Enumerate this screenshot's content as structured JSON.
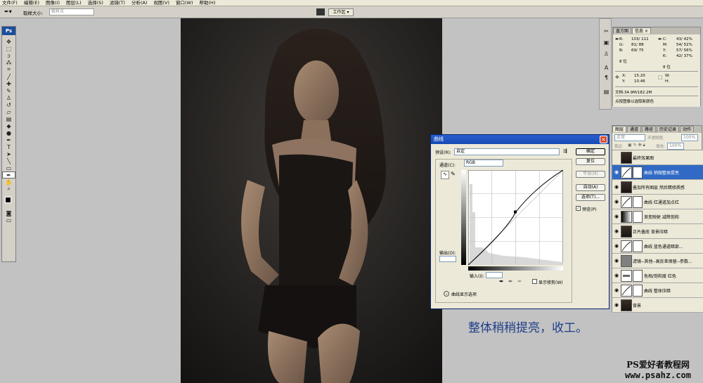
{
  "menubar": [
    "文件(F)",
    "编辑(E)",
    "图像(I)",
    "图层(L)",
    "选择(S)",
    "滤镜(T)",
    "分析(A)",
    "视图(V)",
    "窗口(W)",
    "帮助(H)"
  ],
  "optbar": {
    "sample_label": "取样大小:",
    "sample_value": "取样点",
    "workspace": "工作区 ▾"
  },
  "toolbox": {
    "logo": "Ps"
  },
  "curves": {
    "title": "曲线",
    "preset_label": "预设(R):",
    "preset_value": "自定",
    "channel_label": "通道(C):",
    "channel_value": "RGB",
    "output_label": "输出(O):",
    "input_label": "输入(I):",
    "show_clip": "显示修剪(W)",
    "display_options": "曲线显示选项",
    "buttons": {
      "ok": "确定",
      "reset": "复位",
      "smooth": "平滑(M)",
      "auto": "自动(A)",
      "options": "选项(T)..."
    },
    "preview": "预览(P)"
  },
  "info": {
    "tabs": [
      "直方图",
      "信息 ×"
    ],
    "rgb_labels": [
      "R:",
      "G:",
      "B:"
    ],
    "rgb_values": [
      "103/ 111",
      "81/ 88",
      "69/ 75"
    ],
    "cmyk_labels": [
      "C:",
      "M:",
      "Y:",
      "K:"
    ],
    "cmyk_values": [
      "43/ 42%",
      "54/ 52%",
      "57/ 56%",
      "42/ 37%"
    ],
    "bit1": "8 位",
    "bit2": "8 位",
    "x_label": "X:",
    "x_value": "15.20",
    "y_label": "Y:",
    "y_value": "10.46",
    "w_label": "W:",
    "h_label": "H:",
    "doc": "文档:34.9M/182.2M",
    "hint": "点按图像以选取新颜色"
  },
  "layers": {
    "tabs": [
      "图层",
      "通道",
      "路径",
      "历史记录",
      "动作"
    ],
    "blend_mode": "正常",
    "opacity_label": "不透明度:",
    "opacity_value": "100%",
    "lock_label": "锁定:",
    "fill_label": "填充:",
    "fill_value": "100%",
    "items": [
      {
        "name": "最终效果图",
        "visible": false,
        "selected": false,
        "kind": "photo"
      },
      {
        "name": "曲线 稍微整体提亮",
        "visible": true,
        "selected": true,
        "kind": "curve"
      },
      {
        "name": "叠加所有图层 然后精修质感",
        "visible": true,
        "selected": false,
        "kind": "photo"
      },
      {
        "name": "曲线 红通道加点红",
        "visible": true,
        "selected": false,
        "kind": "curve"
      },
      {
        "name": "渐变映射 减降饱和",
        "visible": true,
        "selected": false,
        "kind": "grad"
      },
      {
        "name": "正片叠底 背景压暗",
        "visible": true,
        "selected": false,
        "kind": "photo"
      },
      {
        "name": "曲线 蓝色通道暗部...",
        "visible": true,
        "selected": false,
        "kind": "curve"
      },
      {
        "name": "滤镜--其他--高反差保留--参数...",
        "visible": true,
        "selected": false,
        "kind": "gray"
      },
      {
        "name": "色相/饱和度 红色",
        "visible": true,
        "selected": false,
        "kind": "hue"
      },
      {
        "name": "曲线 整体压暗",
        "visible": true,
        "selected": false,
        "kind": "curve"
      },
      {
        "name": "背景",
        "visible": true,
        "selected": false,
        "kind": "photo"
      }
    ]
  },
  "caption": "整体稍稍提亮，收工。",
  "watermark": {
    "line1": "PS爱好者教程网",
    "line2": "www.psahz.com"
  }
}
